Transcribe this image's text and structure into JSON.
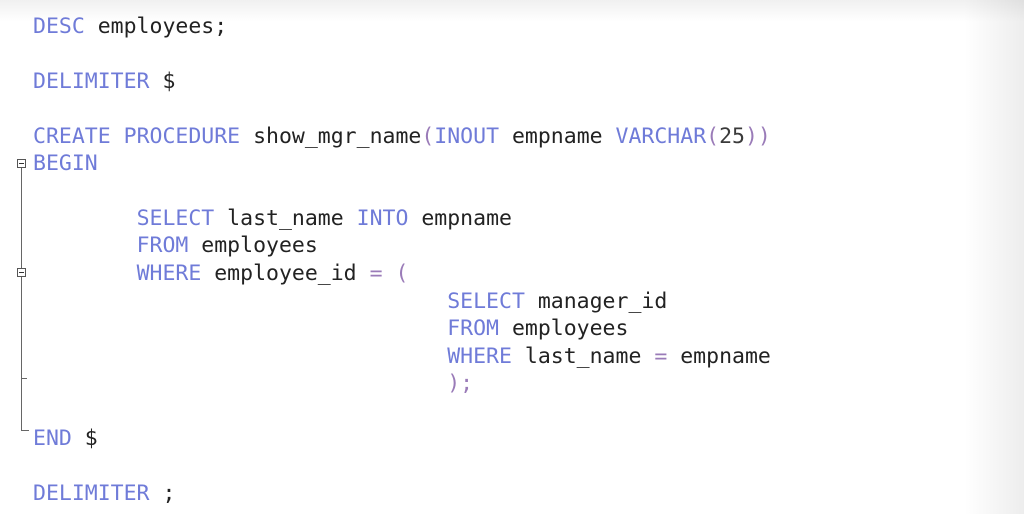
{
  "code": {
    "line1": {
      "kw": "DESC",
      "rest": " employees;"
    },
    "line2": {
      "kw": "DELIMITER",
      "rest": " $"
    },
    "line3": {
      "kw1": "CREATE",
      "sp1": " ",
      "kw2": "PROCEDURE",
      "name": " show_mgr_name",
      "open": "(",
      "kw3": "INOUT",
      "param": " empname ",
      "kw4": "VARCHAR",
      "open2": "(",
      "num": "25",
      "close": "))"
    },
    "line4": {
      "kw": "BEGIN"
    },
    "line5": {
      "indent": "        ",
      "kw1": "SELECT",
      "mid": " last_name ",
      "kw2": "INTO",
      "rest": " empname"
    },
    "line6": {
      "indent": "        ",
      "kw": "FROM",
      "rest": " employees"
    },
    "line7": {
      "indent": "        ",
      "kw": "WHERE",
      "rest": " employee_id ",
      "eq": "=",
      "sp": " ",
      "open": "("
    },
    "line8": {
      "indent": "                                ",
      "kw": "SELECT",
      "rest": " manager_id"
    },
    "line9": {
      "indent": "                                ",
      "kw": "FROM",
      "rest": " employees"
    },
    "line10": {
      "indent": "                                ",
      "kw": "WHERE",
      "rest": " last_name ",
      "eq": "=",
      "rest2": " empname"
    },
    "line11": {
      "indent": "                                ",
      "close": ");"
    },
    "line12": {
      "kw": "END",
      "rest": " $"
    },
    "line13": {
      "kw": "DELIMITER",
      "rest": " ;"
    }
  },
  "colors": {
    "keyword": "#6f7bd8",
    "text": "#222222",
    "background": "#ffffff"
  }
}
